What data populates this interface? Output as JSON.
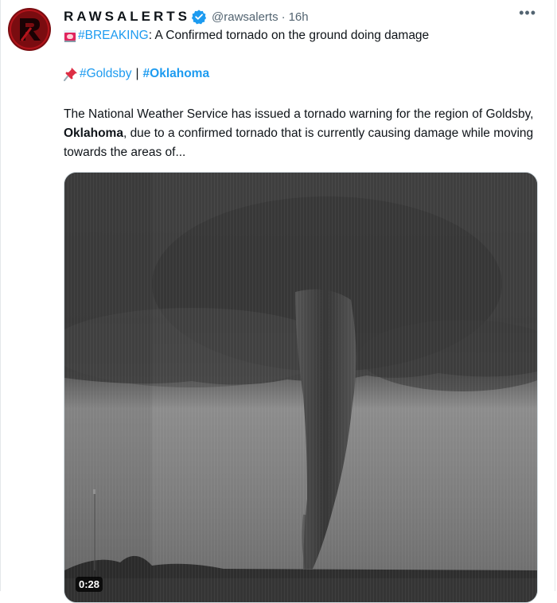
{
  "tweet": {
    "author_name": "RAWSALERTS",
    "handle": "@rawsalerts",
    "separator": "·",
    "time": "16h",
    "more_label": "•••",
    "breaking_tag": "#BREAKING",
    "breaking_text": ": A Confirmed tornado on the ground doing damage",
    "tag_goldsby": "#Goldsby",
    "tag_separator": "|",
    "tag_oklahoma": "#Oklahoma",
    "body_part1": "The National Weather Service has issued a tornado warning for the region of Goldsby, ",
    "body_bold": "Oklahoma",
    "body_part2": ", due to a confirmed tornado that is currently causing damage while moving towards the areas of...",
    "video_duration": "0:28"
  },
  "colors": {
    "link": "#1d9bf0",
    "verified": "#1d9bf0",
    "avatar": "#7a0c10",
    "muted_text": "#536471"
  },
  "icons": [
    "verified-badge-icon",
    "siren-emoji-icon",
    "pushpin-emoji-icon",
    "more-options-icon"
  ]
}
